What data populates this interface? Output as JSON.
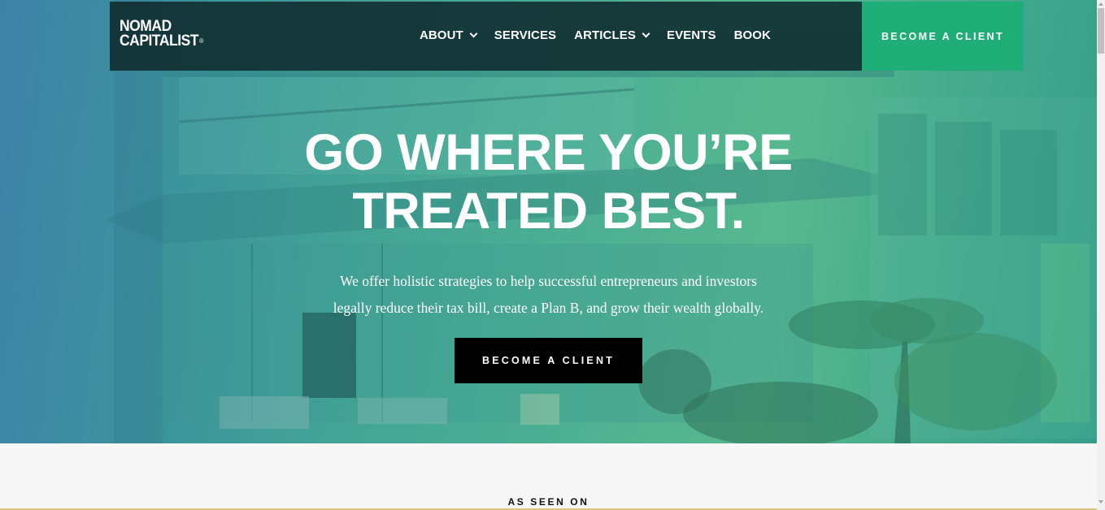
{
  "brand": {
    "line1": "NOMAD",
    "line2": "CAPITALIST",
    "mark": "®"
  },
  "nav": {
    "items": [
      {
        "label": "ABOUT",
        "dropdown": true
      },
      {
        "label": "SERVICES",
        "dropdown": false
      },
      {
        "label": "ARTICLES",
        "dropdown": true
      },
      {
        "label": "EVENTS",
        "dropdown": false
      },
      {
        "label": "BOOK",
        "dropdown": false
      }
    ],
    "cta_label": "BECOME A CLIENT"
  },
  "hero": {
    "headline_line1": "GO WHERE YOU’RE",
    "headline_line2": "TREATED BEST.",
    "sub_line1": "We offer holistic strategies to help successful entrepreneurs and investors",
    "sub_line2": "legally reduce their tax bill, create a Plan B, and grow their wealth globally.",
    "cta_label": "BECOME A CLIENT"
  },
  "section": {
    "seen_on": "AS SEEN ON"
  },
  "colors": {
    "nav_bg": "#112e31",
    "accent_green": "#1fae78",
    "cta_black": "#000000",
    "hero_teal": "#49ad95"
  }
}
